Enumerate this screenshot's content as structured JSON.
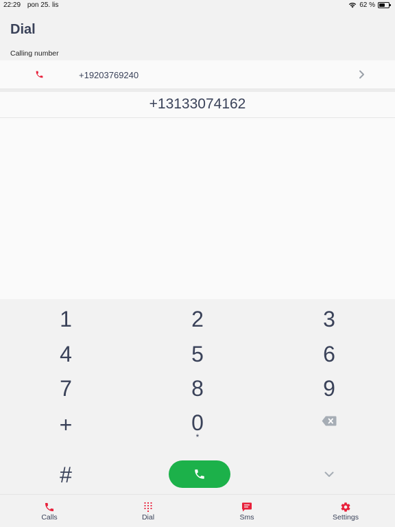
{
  "status_bar": {
    "time": "22:29",
    "date": "pon 25. lis",
    "battery_percent_text": "62 %",
    "battery_level": 0.62
  },
  "header": {
    "title": "Dial"
  },
  "calling": {
    "section_label": "Calling number",
    "number": "+19203769240",
    "icon": "phone-icon",
    "accent_color": "#e8213b"
  },
  "dialer": {
    "number": "+13133074162"
  },
  "keypad": {
    "keys": [
      "1",
      "2",
      "3",
      "4",
      "5",
      "6",
      "7",
      "8",
      "9",
      "+",
      "0",
      "#"
    ],
    "zero_sub": "*",
    "delete_icon": "backspace-icon",
    "collapse_icon": "chevron-down-icon",
    "call_icon": "phone-icon",
    "call_color": "#1cb14a"
  },
  "tabs": [
    {
      "label": "Calls",
      "icon": "phone-icon"
    },
    {
      "label": "Dial",
      "icon": "dialpad-icon"
    },
    {
      "label": "Sms",
      "icon": "message-icon"
    },
    {
      "label": "Settings",
      "icon": "gear-icon"
    }
  ]
}
